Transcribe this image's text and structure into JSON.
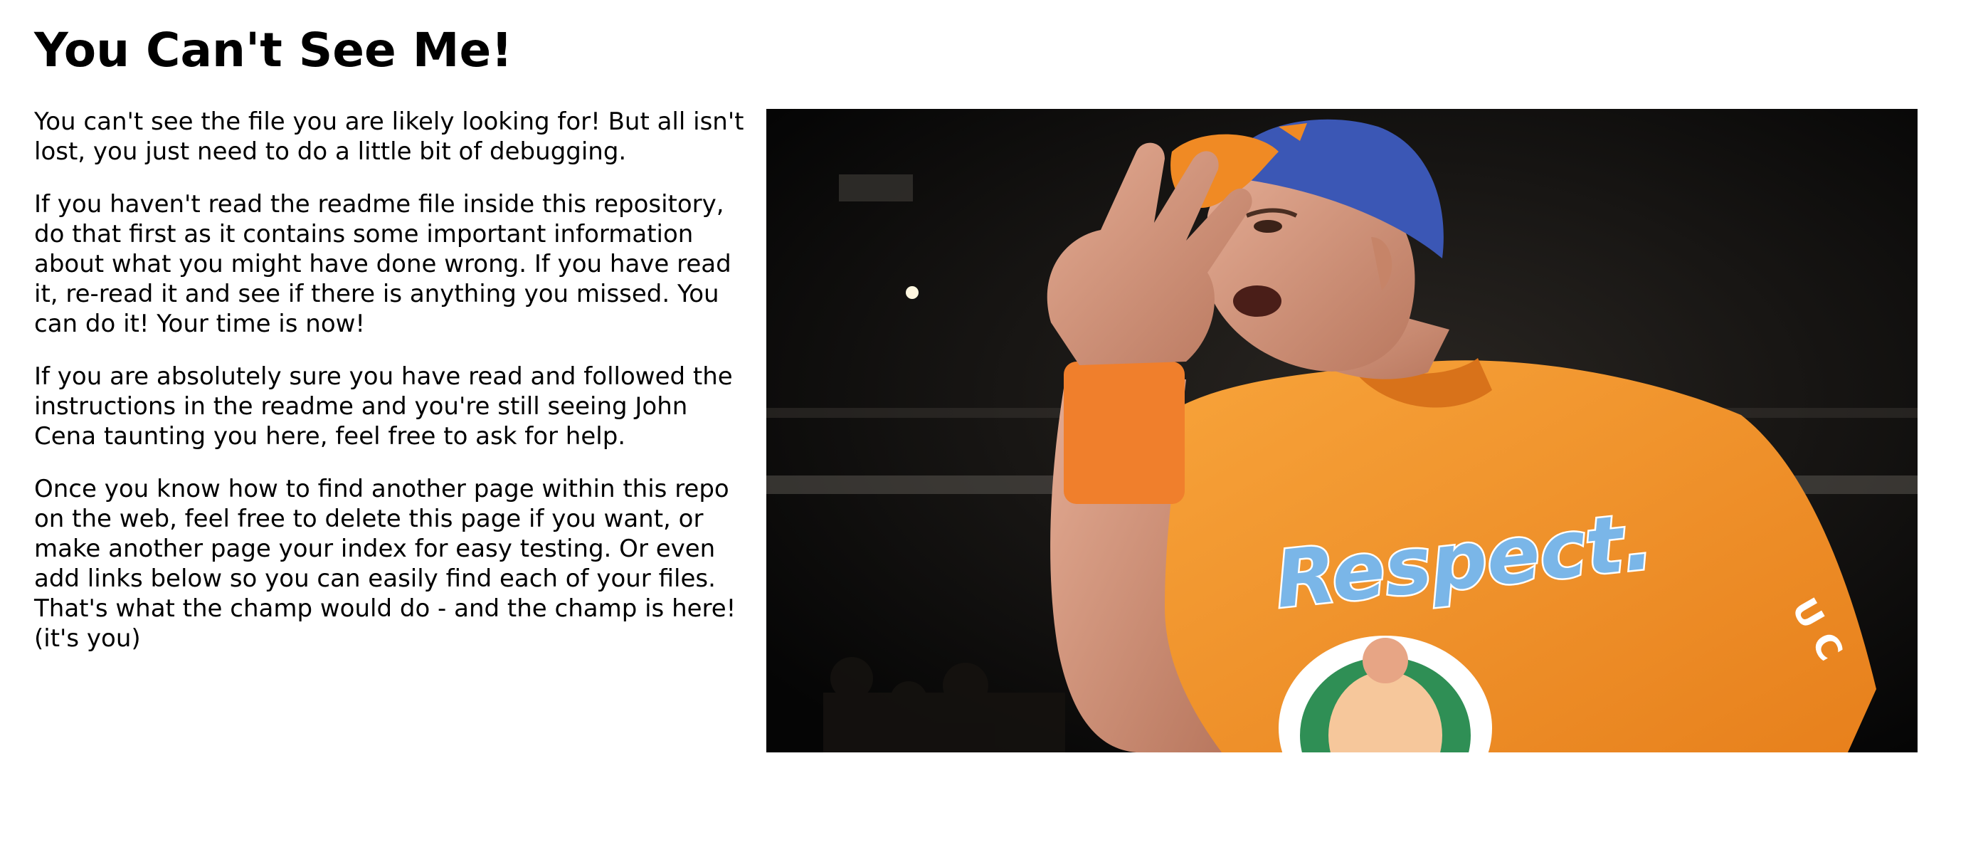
{
  "page": {
    "title": "You Can't See Me!",
    "paragraphs": [
      "You can't see the file you are likely looking for! But all isn't lost, you just need to do a little bit of debugging.",
      "If you haven't read the readme file inside this repository, do that first as it contains some important information about what you might have done wrong. If you have read it, re-read it and see if there is anything you missed. You can do it! Your time is now!",
      "If you are absolutely sure you have read and followed the instructions in the readme and you're still seeing John Cena taunting you here, feel free to ask for help.",
      "Once you know how to find another page within this repo on the web, feel free to delete this page if you want, or make another page your index for easy testing. Or even add links below so you can easily find each of your files. That's what the champ would do - and the champ is here! (it's you)"
    ]
  },
  "photo": {
    "shirt_text": "Respect.",
    "sleeve_text": "U C",
    "colors": {
      "shirt": "#f39326",
      "cap_blue": "#3b57b5",
      "cap_brim": "#f08a24",
      "wristband": "#f07f2c",
      "skin": "#d69a83",
      "background": "#0a0908",
      "shirt_text": "#7ab6e8"
    }
  }
}
